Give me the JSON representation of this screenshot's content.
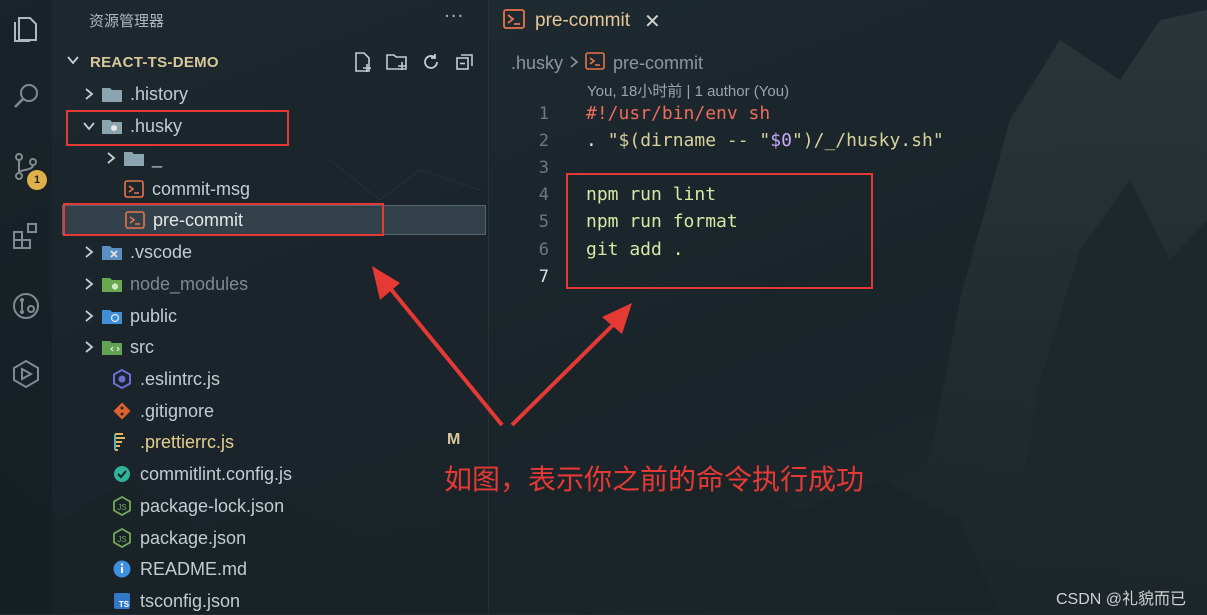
{
  "explorer": {
    "title": "资源管理器",
    "more": "···",
    "project": "REACT-TS-DEMO",
    "scm_badge": "1",
    "items": [
      {
        "label": ".history"
      },
      {
        "label": ".husky"
      },
      {
        "label": "_"
      },
      {
        "label": "commit-msg"
      },
      {
        "label": "pre-commit"
      },
      {
        "label": ".vscode"
      },
      {
        "label": "node_modules"
      },
      {
        "label": "public"
      },
      {
        "label": "src"
      },
      {
        "label": ".eslintrc.js"
      },
      {
        "label": ".gitignore"
      },
      {
        "label": ".prettierrc.js",
        "status": "M"
      },
      {
        "label": "commitlint.config.js"
      },
      {
        "label": "package-lock.json"
      },
      {
        "label": "package.json"
      },
      {
        "label": "README.md"
      },
      {
        "label": "tsconfig.json"
      }
    ]
  },
  "editor": {
    "tab_label": "pre-commit",
    "tab_close": "✕",
    "breadcrumb": [
      ".husky",
      "pre-commit"
    ],
    "blame": "You, 18小时前 | 1 author (You)",
    "line_numbers": [
      "1",
      "2",
      "3",
      "4",
      "5",
      "6",
      "7"
    ],
    "lines": {
      "l1": "#!/usr/bin/env sh",
      "l2a": ". ",
      "l2b": "\"$(dirname -- \"",
      "l2c": "$0",
      "l2d": "\")/_/husky.sh\"",
      "l4": "npm run lint",
      "l5": "npm run format",
      "l6": "git add ."
    }
  },
  "annotation": "如图，表示你之前的命令执行成功",
  "watermark": "CSDN @礼貌而已",
  "colors": {
    "accent_red": "#e53935",
    "folder": "#8aa4b0",
    "shell_icon": "#e8734a"
  }
}
